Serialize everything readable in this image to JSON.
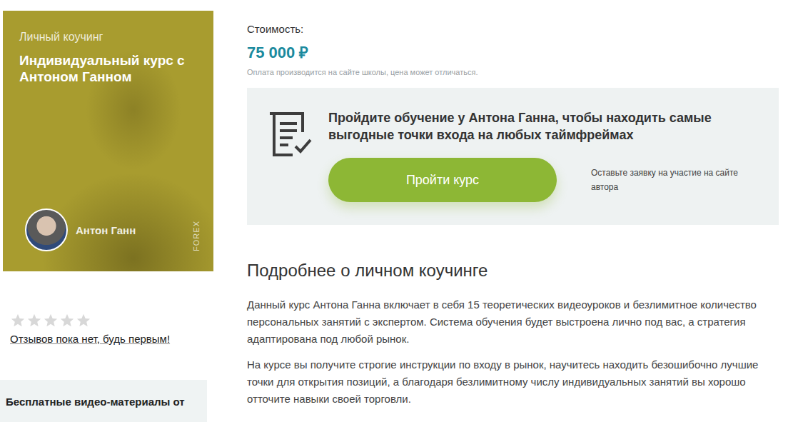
{
  "card": {
    "category": "Личный коучинг",
    "title": "Индивидуальный курс с Антоном Ганном",
    "author": "Антон Ганн",
    "market": "FOREX"
  },
  "rating": {
    "stars": 0,
    "reviews_link": "Отзывов пока нет, будь первым!"
  },
  "side_box": {
    "title": "Бесплатные видео-материалы от"
  },
  "price": {
    "label": "Стоимость:",
    "value": "75 000 ₽",
    "note": "Оплата производится на сайте школы, цена может отличаться."
  },
  "cta": {
    "text": "Пройдите обучение у Антона Ганна, чтобы находить самые выгодные точки входа на любых таймфреймах",
    "button": "Пройти курс",
    "note": "Оставьте заявку на участие на сайте автора"
  },
  "details": {
    "heading": "Подробнее о личном коучинге",
    "paragraphs": [
      "Данный курс Антона Ганна включает в себя 15 теоретических видеоуроков и безлимитное количество персональных занятий с экспертом. Система обучения будет выстроена лично под вас, а стратегия адаптирована под любой рынок.",
      "На курсе вы получите строгие инструкции по входу в рынок, научитесь находить безошибочно лучшие точки для открытия позиций, а благодаря безлимитному числу индивидуальных занятий вы хорошо отточите навыки своей торговли."
    ]
  }
}
